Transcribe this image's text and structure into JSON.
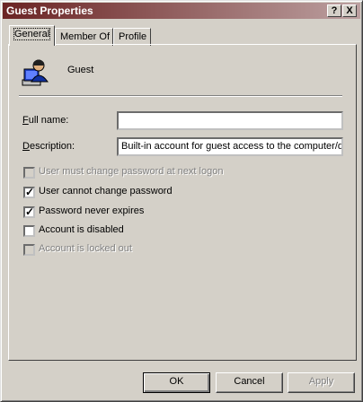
{
  "window": {
    "title": "Guest Properties",
    "help_glyph": "?",
    "close_glyph": "X"
  },
  "tabs": [
    {
      "label": "General",
      "active": true
    },
    {
      "label": "Member Of",
      "active": false
    },
    {
      "label": "Profile",
      "active": false
    }
  ],
  "user": {
    "name": "Guest",
    "icon": "user-account-icon"
  },
  "fields": {
    "full_name": {
      "label_first": "F",
      "label_rest": "ull name:",
      "value": ""
    },
    "description": {
      "label_first": "D",
      "label_rest": "escription:",
      "value": "Built-in account for guest access to the computer/do"
    }
  },
  "options": [
    {
      "label": "User must change password at next logon",
      "checked": false,
      "enabled": false
    },
    {
      "label": "User cannot change password",
      "checked": true,
      "enabled": true
    },
    {
      "label": "Password never expires",
      "checked": true,
      "enabled": true
    },
    {
      "label": "Account is disabled",
      "checked": false,
      "enabled": true
    },
    {
      "label": "Account is locked out",
      "checked": false,
      "enabled": false
    }
  ],
  "buttons": {
    "ok": "OK",
    "cancel": "Cancel",
    "apply": "Apply"
  }
}
